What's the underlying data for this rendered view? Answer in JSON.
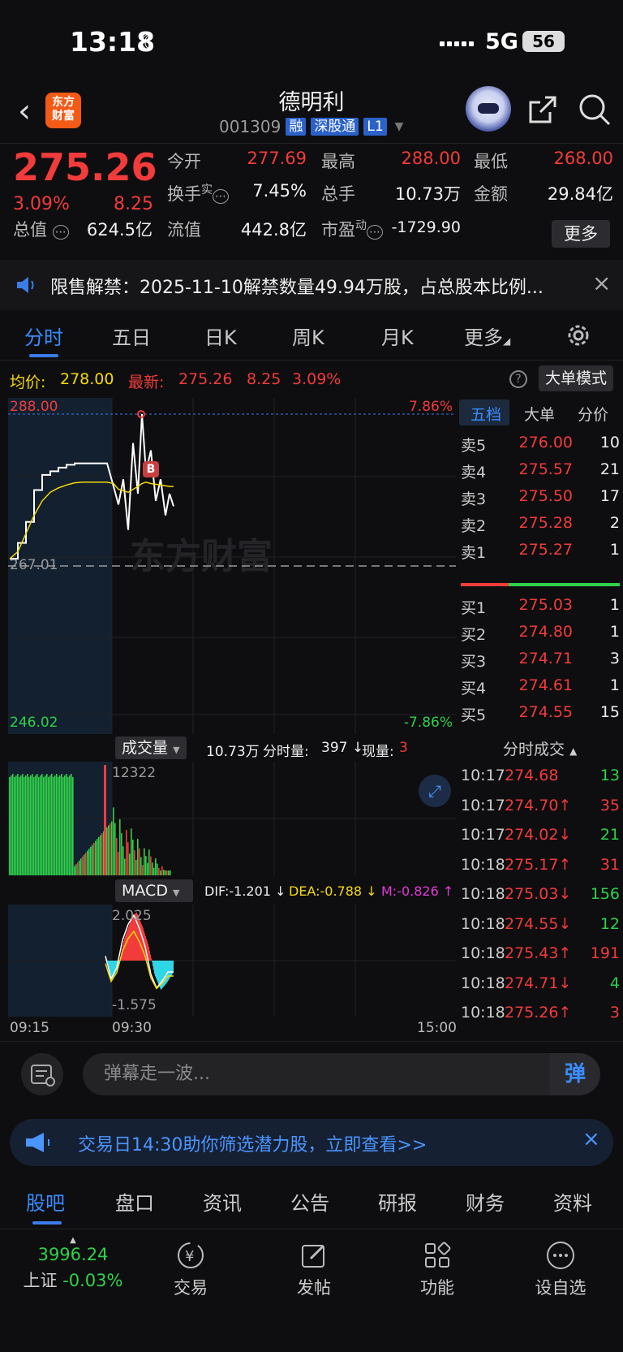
{
  "status_bar": {
    "time": "13:18",
    "network": "5G",
    "battery": "56"
  },
  "header": {
    "back": "‹",
    "logo_line1": "东方",
    "logo_line2": "财富",
    "stock_name": "德明利",
    "stock_code": "001309",
    "tags": [
      "融",
      "深股通",
      "L1"
    ]
  },
  "quote": {
    "price": "275.26",
    "change_pct": "3.09%",
    "change": "8.25",
    "open_label": "今开",
    "open": "277.69",
    "high_label": "最高",
    "high": "288.00",
    "low_label": "最低",
    "low": "268.00",
    "turnover_label": "换手",
    "turnover_sup": "实",
    "turnover": "7.45%",
    "volume_label": "总手",
    "volume": "10.73万",
    "amount_label": "金额",
    "amount": "29.84亿",
    "mktcap_label": "总值",
    "mktcap": "624.5亿",
    "float_label": "流值",
    "float": "442.8亿",
    "pe_label": "市盈",
    "pe_sup": "动",
    "pe": "-1729.90",
    "more": "更多"
  },
  "notice": {
    "text": "限售解禁：2025-11-10解禁数量49.94万股，占总股本比例...",
    "close": "×"
  },
  "tabs": [
    "分时",
    "五日",
    "日K",
    "周K",
    "月K",
    "更多"
  ],
  "info_line": {
    "avg_label": "均价:",
    "avg": "278.00",
    "latest_label": "最新:",
    "latest": "275.26",
    "latest_chg": "8.25",
    "latest_pct": "3.09%",
    "help": "?",
    "big_mode": "大单模式"
  },
  "main_chart": {
    "y_top": "288.00",
    "y_mid": "267.01",
    "y_bottom": "246.02",
    "pct_top": "7.86%",
    "pct_bottom": "-7.86%",
    "watermark": "东方财富",
    "marker": "B"
  },
  "chart_data": {
    "type": "line",
    "title": "",
    "ylim": [
      246.02,
      288.0
    ],
    "prev_close": 267.01,
    "series": [
      {
        "values": [
          268.0,
          270.2,
          273.1,
          277.5,
          279.6,
          280.1,
          280.6,
          281.0,
          281.2,
          281.2,
          281.2,
          281.2,
          281.2,
          278.0,
          275.5,
          279.0,
          272.0,
          284.0,
          277.0,
          288.0,
          280.0,
          283.0,
          276.0,
          279.0,
          274.0,
          277.0,
          275.26
        ]
      },
      {
        "values": [
          268.0,
          269.0,
          271.5,
          274.0,
          276.0,
          277.2,
          277.8,
          278.2,
          278.5,
          278.6,
          278.6,
          278.6,
          278.6,
          278.4,
          277.6,
          277.4,
          277.2,
          277.6,
          278.0,
          278.4,
          278.6,
          278.4,
          278.3,
          278.2,
          278.1,
          278.0,
          278.0
        ]
      }
    ],
    "volume": {
      "max": "12322"
    },
    "macd": {
      "top": "2.025",
      "bottom": "-1.575",
      "values": [
        0.2,
        -0.8,
        -0.3,
        0.9,
        1.6,
        2.0,
        1.4,
        0.6,
        -0.6,
        -1.2,
        -0.9,
        -0.5
      ]
    }
  },
  "order_book": {
    "tabs": [
      "五档",
      "大单",
      "分价"
    ],
    "asks": [
      {
        "label": "卖5",
        "price": "276.00",
        "qty": "10"
      },
      {
        "label": "卖4",
        "price": "275.57",
        "qty": "21"
      },
      {
        "label": "卖3",
        "price": "275.50",
        "qty": "17"
      },
      {
        "label": "卖2",
        "price": "275.28",
        "qty": "2"
      },
      {
        "label": "卖1",
        "price": "275.27",
        "qty": "1"
      }
    ],
    "bids": [
      {
        "label": "买1",
        "price": "275.03",
        "qty": "1"
      },
      {
        "label": "买2",
        "price": "274.80",
        "qty": "1"
      },
      {
        "label": "买3",
        "price": "274.71",
        "qty": "3"
      },
      {
        "label": "买4",
        "price": "274.61",
        "qty": "1"
      },
      {
        "label": "买5",
        "price": "274.55",
        "qty": "15"
      }
    ]
  },
  "volume_panel": {
    "selector": "成交量",
    "total": "10.73万",
    "minute_label": "分时量:",
    "minute": "397 ↓",
    "current_label": "现量:",
    "current": "3",
    "max_label": "12322"
  },
  "macd_panel": {
    "selector": "MACD",
    "dif": "DIF:-1.201 ↓",
    "dea": "DEA:-0.788 ↓",
    "m": "M:-0.826 ↑",
    "top": "2.025",
    "bottom": "-1.575"
  },
  "time_axis": {
    "start": "09:15",
    "open": "09:30",
    "end": "15:00"
  },
  "ticks": {
    "title": "分时成交",
    "rows": [
      {
        "time": "10:17",
        "price": "274.68",
        "dir": "",
        "qty": "13",
        "pc": "red",
        "qc": "green"
      },
      {
        "time": "10:17",
        "price": "274.70↑",
        "dir": "",
        "qty": "35",
        "pc": "red",
        "qc": "red"
      },
      {
        "time": "10:17",
        "price": "274.02↓",
        "dir": "",
        "qty": "21",
        "pc": "red",
        "qc": "green"
      },
      {
        "time": "10:18",
        "price": "275.17↑",
        "dir": "",
        "qty": "31",
        "pc": "red",
        "qc": "red"
      },
      {
        "time": "10:18",
        "price": "275.03↓",
        "dir": "",
        "qty": "156",
        "pc": "red",
        "qc": "green"
      },
      {
        "time": "10:18",
        "price": "274.55↓",
        "dir": "",
        "qty": "12",
        "pc": "red",
        "qc": "green"
      },
      {
        "time": "10:18",
        "price": "275.43↑",
        "dir": "",
        "qty": "191",
        "pc": "red",
        "qc": "red"
      },
      {
        "time": "10:18",
        "price": "274.71↓",
        "dir": "",
        "qty": "4",
        "pc": "red",
        "qc": "green"
      },
      {
        "time": "10:18",
        "price": "275.26↑",
        "dir": "",
        "qty": "3",
        "pc": "red",
        "qc": "red"
      }
    ]
  },
  "danmu": {
    "placeholder": "弹幕走一波...",
    "button": "弹"
  },
  "promo": {
    "text": "交易日14:30助你筛选潜力股，立即查看>>",
    "close": "×"
  },
  "bottom_tabs": [
    "股吧",
    "盘口",
    "资讯",
    "公告",
    "研报",
    "财务",
    "资料"
  ],
  "navbar": {
    "index_value": "3996.24",
    "index_name": "上证",
    "index_pct": "-0.03%",
    "items": [
      "交易",
      "发帖",
      "功能",
      "设自选"
    ]
  },
  "colors": {
    "up": "#f23b3b",
    "down": "#2fd14a",
    "accent": "#3a7de8",
    "avg_line": "#f5d90a"
  }
}
